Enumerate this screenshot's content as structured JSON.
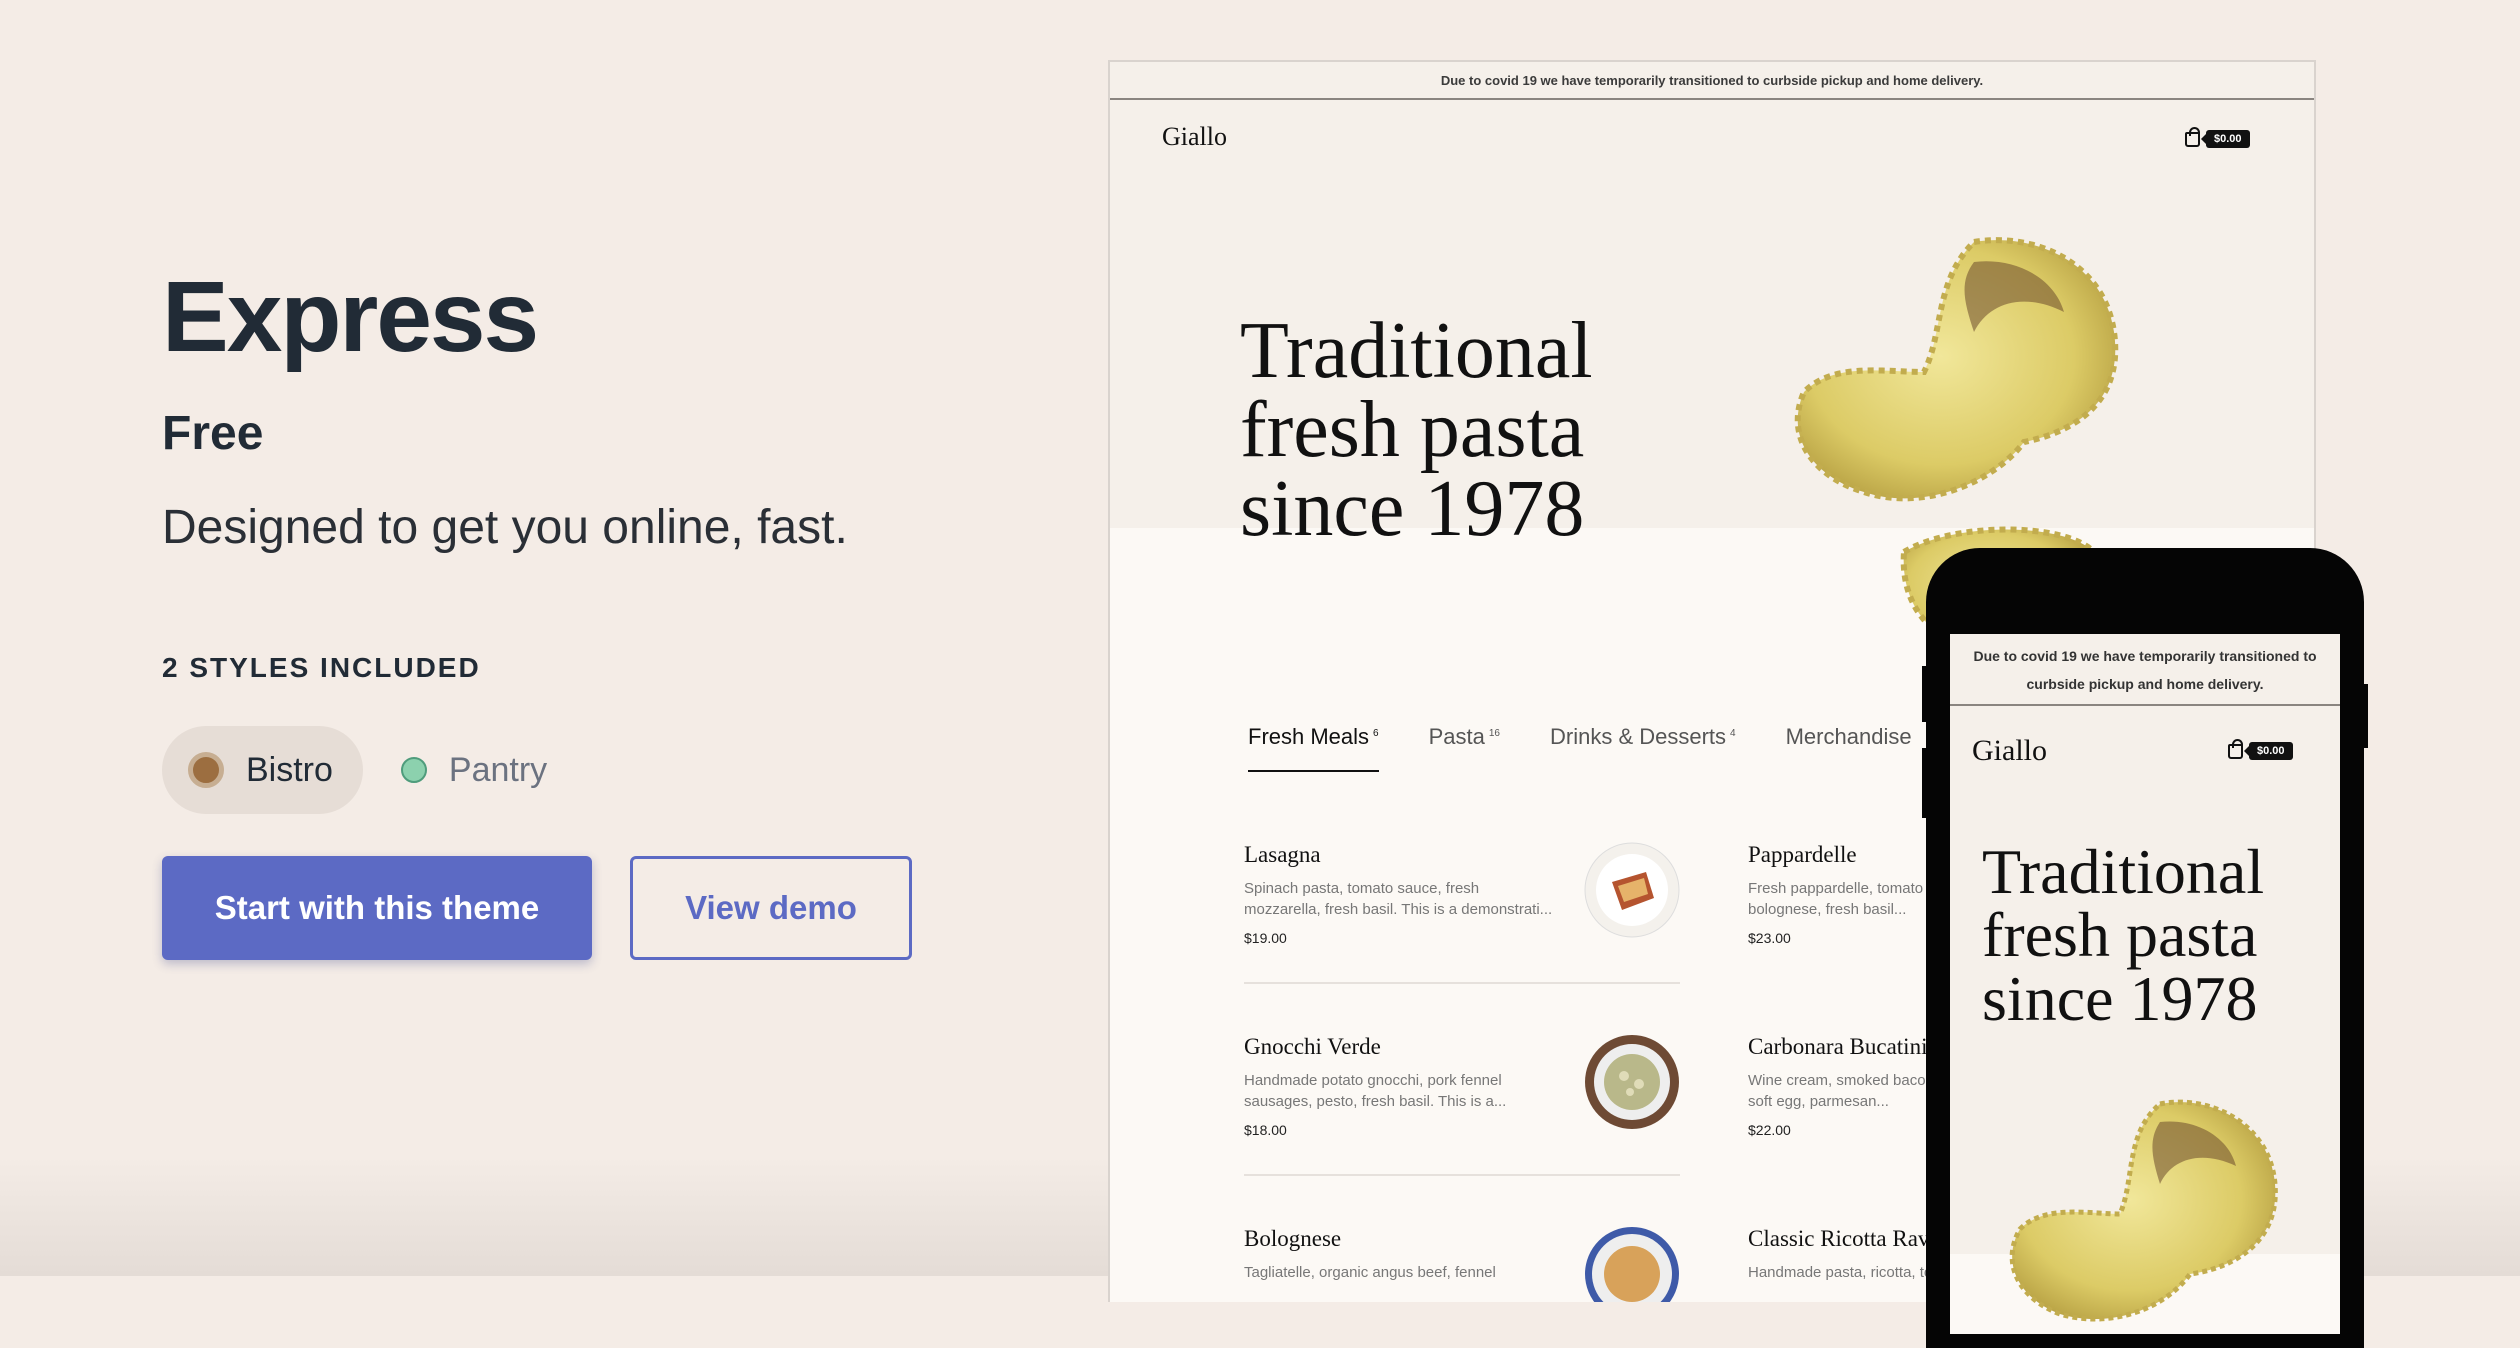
{
  "theme": {
    "name": "Express",
    "price": "Free",
    "tagline": "Designed to get you online, fast.",
    "styles_label": "2 STYLES INCLUDED",
    "styles": [
      {
        "label": "Bistro",
        "color": "#9c6e40",
        "selected": true
      },
      {
        "label": "Pantry",
        "color": "#8cd1ae",
        "selected": false
      }
    ],
    "primary_button": "Start with this theme",
    "secondary_button": "View demo",
    "accent_color": "#5c6ac4"
  },
  "preview": {
    "announcement": "Due to covid 19 we have temporarily transitioned to curbside pickup and home delivery.",
    "store_name": "Giallo",
    "cart_total": "$0.00",
    "hero_lines": [
      "Traditional",
      "fresh pasta",
      "since 1978"
    ],
    "tabs": [
      {
        "label": "Fresh Meals",
        "count": "6",
        "active": true
      },
      {
        "label": "Pasta",
        "count": "16",
        "active": false
      },
      {
        "label": "Drinks & Desserts",
        "count": "4",
        "active": false
      },
      {
        "label": "Merchandise",
        "count": "",
        "active": false
      }
    ],
    "menu": [
      {
        "name": "Lasagna",
        "desc": "Spinach pasta, tomato sauce, fresh mozzarella, fresh basil. This is a demonstrati...",
        "price": "$19.00"
      },
      {
        "name": "Pappardelle",
        "desc": "Fresh pappardelle, tomato and vegan bolognese, fresh basil...",
        "price": "$23.00"
      },
      {
        "name": "Gnocchi Verde",
        "desc": "Handmade potato gnocchi, pork fennel sausages, pesto, fresh basil. This is a...",
        "price": "$18.00"
      },
      {
        "name": "Carbonara Bucatini",
        "desc": "Wine cream, smoked bacon, black pepper, soft egg, parmesan...",
        "price": "$22.00"
      },
      {
        "name": "Bolognese",
        "desc": "Tagliatelle, organic angus beef, fennel",
        "price": ""
      },
      {
        "name": "Classic Ricotta Ravioli",
        "desc": "Handmade pasta, ricotta, tomato",
        "price": ""
      }
    ]
  }
}
